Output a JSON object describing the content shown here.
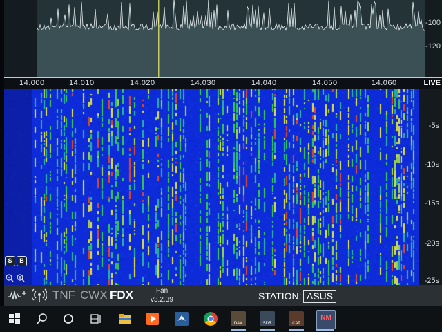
{
  "panadapter": {
    "db_labels": [
      "-100",
      "-120"
    ]
  },
  "frequency_axis": {
    "ticks": [
      {
        "label": "14.000",
        "mhz": 14.0
      },
      {
        "label": "14.010",
        "mhz": 14.01
      },
      {
        "label": "14.020",
        "mhz": 14.02
      },
      {
        "label": "14.030",
        "mhz": 14.03
      },
      {
        "label": "14.040",
        "mhz": 14.04
      },
      {
        "label": "14.050",
        "mhz": 14.05
      },
      {
        "label": "14.060",
        "mhz": 14.06
      }
    ],
    "live_label": "LIVE",
    "tuned_mhz": 14.0225
  },
  "waterfall": {
    "time_labels": [
      "-5s",
      "-10s",
      "-15s",
      "-20s",
      "-25s"
    ],
    "buttons": {
      "s_label": "S",
      "b_label": "B"
    }
  },
  "status_bar": {
    "tnf": "TNF",
    "cwx": "CWX",
    "fdx": "FDX",
    "fan_label": "Fan",
    "version": "v3.2.39",
    "station_label": "STATION:",
    "station_value": "ASUS"
  },
  "taskbar": {
    "apps": [
      {
        "name": "DAX",
        "label": "DAX",
        "color": "#5a4a3a"
      },
      {
        "name": "SDR",
        "label": "SDR",
        "color": "#3a4a5a"
      },
      {
        "name": "CAT",
        "label": "CAT",
        "color": "#5a3a2a"
      },
      {
        "name": "DXLab",
        "label": "NM",
        "color": "#c04040"
      }
    ]
  },
  "colors": {
    "waterfall_bg": "#0d2bd8",
    "signal_green": "#3ad04a",
    "signal_yellow": "#e8e840",
    "signal_red": "#e04a2a",
    "tuned_marker": "#e8ea60"
  }
}
